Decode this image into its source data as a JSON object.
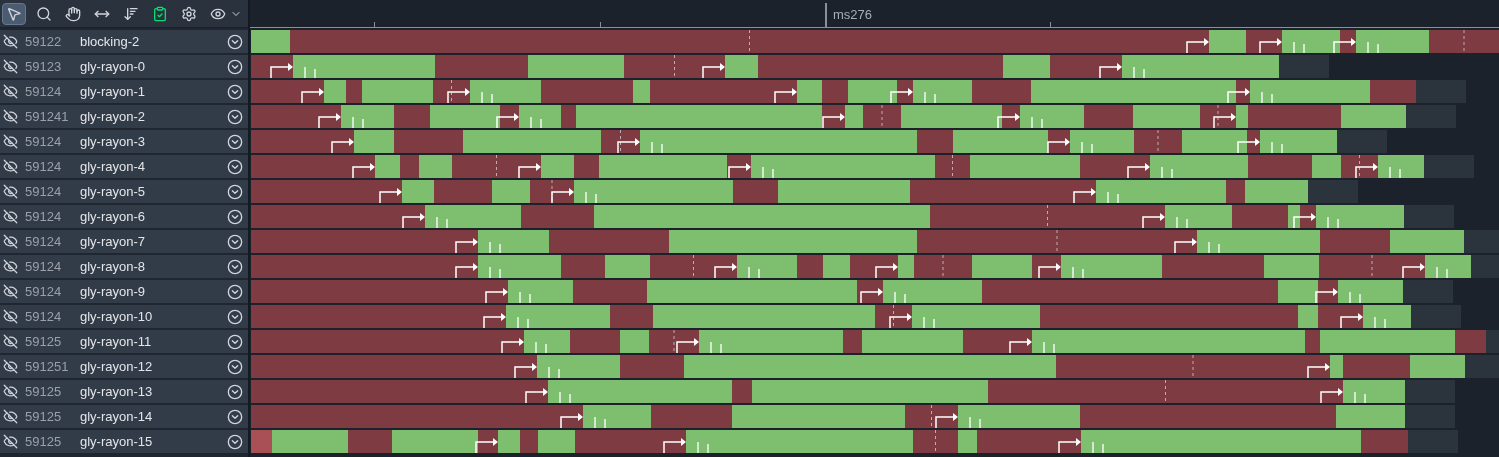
{
  "toolbar": {
    "tools": [
      {
        "kind": "pointer",
        "selected": true
      },
      {
        "kind": "zoom",
        "selected": false
      },
      {
        "kind": "pan",
        "selected": false
      },
      {
        "kind": "fit",
        "selected": false
      },
      {
        "kind": "sort",
        "selected": false
      },
      {
        "kind": "report",
        "selected": false
      },
      {
        "kind": "add-config",
        "selected": false
      },
      {
        "kind": "visibility",
        "selected": false
      }
    ]
  },
  "timeline": {
    "marker_label": "ms276"
  },
  "threads": [
    {
      "id": "59122",
      "name": "blocking-2",
      "visible": false
    },
    {
      "id": "59123",
      "name": "gly-rayon-0",
      "visible": false
    },
    {
      "id": "59124",
      "name": "gly-rayon-1",
      "visible": false
    },
    {
      "id": "591241",
      "name": "gly-rayon-2",
      "visible": false
    },
    {
      "id": "59124",
      "name": "gly-rayon-3",
      "visible": false
    },
    {
      "id": "59124",
      "name": "gly-rayon-4",
      "visible": false
    },
    {
      "id": "59124",
      "name": "gly-rayon-5",
      "visible": false
    },
    {
      "id": "59124",
      "name": "gly-rayon-6",
      "visible": false
    },
    {
      "id": "59124",
      "name": "gly-rayon-7",
      "visible": false
    },
    {
      "id": "59124",
      "name": "gly-rayon-8",
      "visible": false
    },
    {
      "id": "59124",
      "name": "gly-rayon-9",
      "visible": false
    },
    {
      "id": "59124",
      "name": "gly-rayon-10",
      "visible": false
    },
    {
      "id": "59125",
      "name": "gly-rayon-11",
      "visible": false
    },
    {
      "id": "591251",
      "name": "gly-rayon-12",
      "visible": false
    },
    {
      "id": "59125",
      "name": "gly-rayon-13",
      "visible": false
    },
    {
      "id": "59125",
      "name": "gly-rayon-14",
      "visible": false
    },
    {
      "id": "59125",
      "name": "gly-rayon-15",
      "visible": false
    }
  ]
}
